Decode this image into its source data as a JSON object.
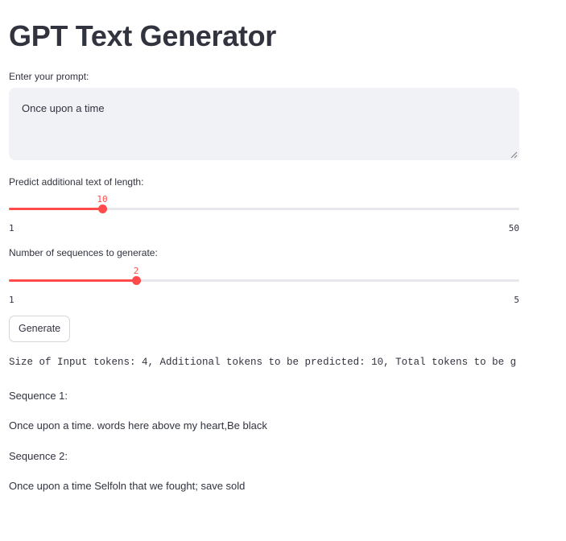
{
  "page": {
    "title": "GPT Text Generator"
  },
  "prompt": {
    "label": "Enter your prompt:",
    "value": "Once upon a time"
  },
  "length_slider": {
    "label": "Predict additional text of length:",
    "value": "10",
    "min": "1",
    "max": "50"
  },
  "sequences_slider": {
    "label": "Number of sequences to generate:",
    "value": "2",
    "min": "1",
    "max": "5"
  },
  "generate_button": {
    "label": "Generate"
  },
  "info": {
    "text": "Size of Input tokens: 4, Additional tokens to be predicted: 10, Total tokens to be g"
  },
  "results": [
    {
      "heading": "Sequence 1:",
      "text": "Once upon a time. words here above my heart,Be black"
    },
    {
      "heading": "Sequence 2:",
      "text": "Once upon a time Selfoln that we fought; save sold"
    }
  ],
  "colors": {
    "accent": "#ff4b4b",
    "text": "#31333f",
    "input_bg": "#f0f2f6"
  }
}
